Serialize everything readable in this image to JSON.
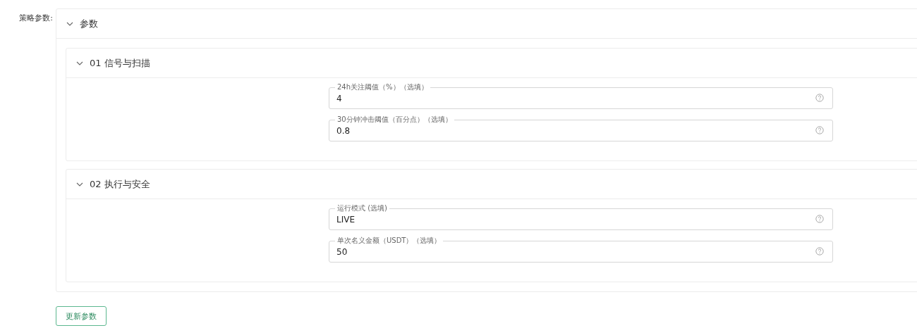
{
  "form_label": "策略参数:",
  "panel": {
    "title": "参数",
    "expanded": true,
    "sections": [
      {
        "title": "01 信号与扫描",
        "expanded": true,
        "fields": [
          {
            "label": "24h关注阈值（%）（选填）",
            "value": "4"
          },
          {
            "label": "30分钟冲击阈值（百分点）（选填）",
            "value": "0.8"
          }
        ]
      },
      {
        "title": "02 执行与安全",
        "expanded": true,
        "fields": [
          {
            "label": "运行模式 (选填)",
            "value": "LIVE"
          },
          {
            "label": "单次名义金额（USDT）（选填）",
            "value": "50"
          }
        ]
      }
    ]
  },
  "button": "更新参数"
}
